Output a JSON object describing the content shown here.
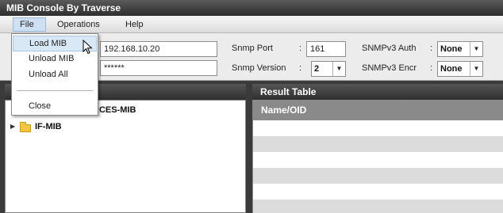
{
  "window": {
    "title": "MIB Console By Traverse"
  },
  "menubar": {
    "file": "File",
    "operations": "Operations",
    "help": "Help"
  },
  "file_menu": {
    "items": [
      "Load MIB",
      "Unload MIB",
      "Unload All",
      "Close"
    ],
    "hovered": "Load MIB"
  },
  "toolbar": {
    "host_value": "192.168.10.20",
    "community_value": "******",
    "snmp_port_label": "Snmp Port",
    "snmp_port_value": "161",
    "snmp_version_label": "Snmp Version",
    "snmp_version_value": "2",
    "snmpv3_auth_label": "SNMPv3 Auth",
    "snmpv3_auth_value": "None",
    "snmpv3_encr_label": "SNMPv3 Encr",
    "snmpv3_encr_value": "None",
    "colon": ":"
  },
  "left_panel": {
    "tree_items": [
      "RCES-MIB",
      "IF-MIB"
    ]
  },
  "right_panel": {
    "title": "Result Table",
    "column_header": "Name/OID"
  },
  "colors": {
    "titlebar": "#2e2e2e",
    "menu_highlight": "#d9e8f7",
    "panel_header": "#3a3a3a",
    "result_header": "#8a8a8a",
    "stripe": "#dcdcdc"
  },
  "icons": [
    "folder-icon",
    "expand-arrow-icon",
    "dropdown-arrow-icon",
    "mouse-pointer-icon"
  ]
}
